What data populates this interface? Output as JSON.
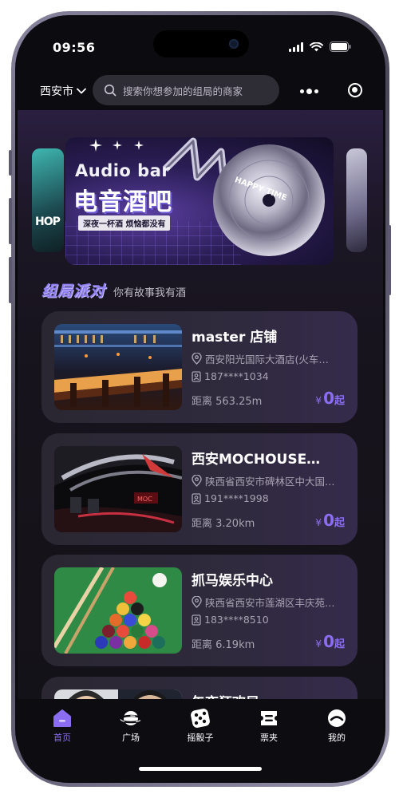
{
  "status_bar": {
    "time": "09:56"
  },
  "header": {
    "city": "西安市",
    "search_placeholder": "搜索你想参加的组局的商家"
  },
  "banner": {
    "title_en": "Audio bar",
    "title_cn": "电音酒吧",
    "tagline": "深夜一杯酒  烦恼都没有",
    "side_text": "HOP",
    "record_text": "HAPPY TIME"
  },
  "section": {
    "title": "组局派对",
    "subtitle": "你有故事我有酒"
  },
  "venues": [
    {
      "name": "master 店铺",
      "address": "西安阳光国际大酒店(火车…",
      "phone": "187****1034",
      "distance": "距离 563.25m",
      "price_symbol": "¥",
      "price": "0",
      "price_suffix": "起"
    },
    {
      "name": "西安MOCHOUSE…",
      "address": "陕西省西安市碑林区中大国…",
      "phone": "191****1998",
      "distance": "距离 3.20km",
      "price_symbol": "¥",
      "price": "0",
      "price_suffix": "起"
    },
    {
      "name": "抓马娱乐中心",
      "address": "陕西省西安市莲湖区丰庆苑…",
      "phone": "183****8510",
      "distance": "距离 6.19km",
      "price_symbol": "¥",
      "price": "0",
      "price_suffix": "起"
    },
    {
      "name": "午夜狂欢局"
    }
  ],
  "tabbar": {
    "items": [
      {
        "label": "首页",
        "icon": "home-icon",
        "active": true
      },
      {
        "label": "广场",
        "icon": "planet-icon",
        "active": false
      },
      {
        "label": "摇骰子",
        "icon": "dice-icon",
        "active": false
      },
      {
        "label": "票夹",
        "icon": "ticket-icon",
        "active": false
      },
      {
        "label": "我的",
        "icon": "profile-icon",
        "active": false
      }
    ]
  },
  "colors": {
    "accent": "#8b6df2",
    "background": "#141218",
    "card": "#2a2732"
  }
}
